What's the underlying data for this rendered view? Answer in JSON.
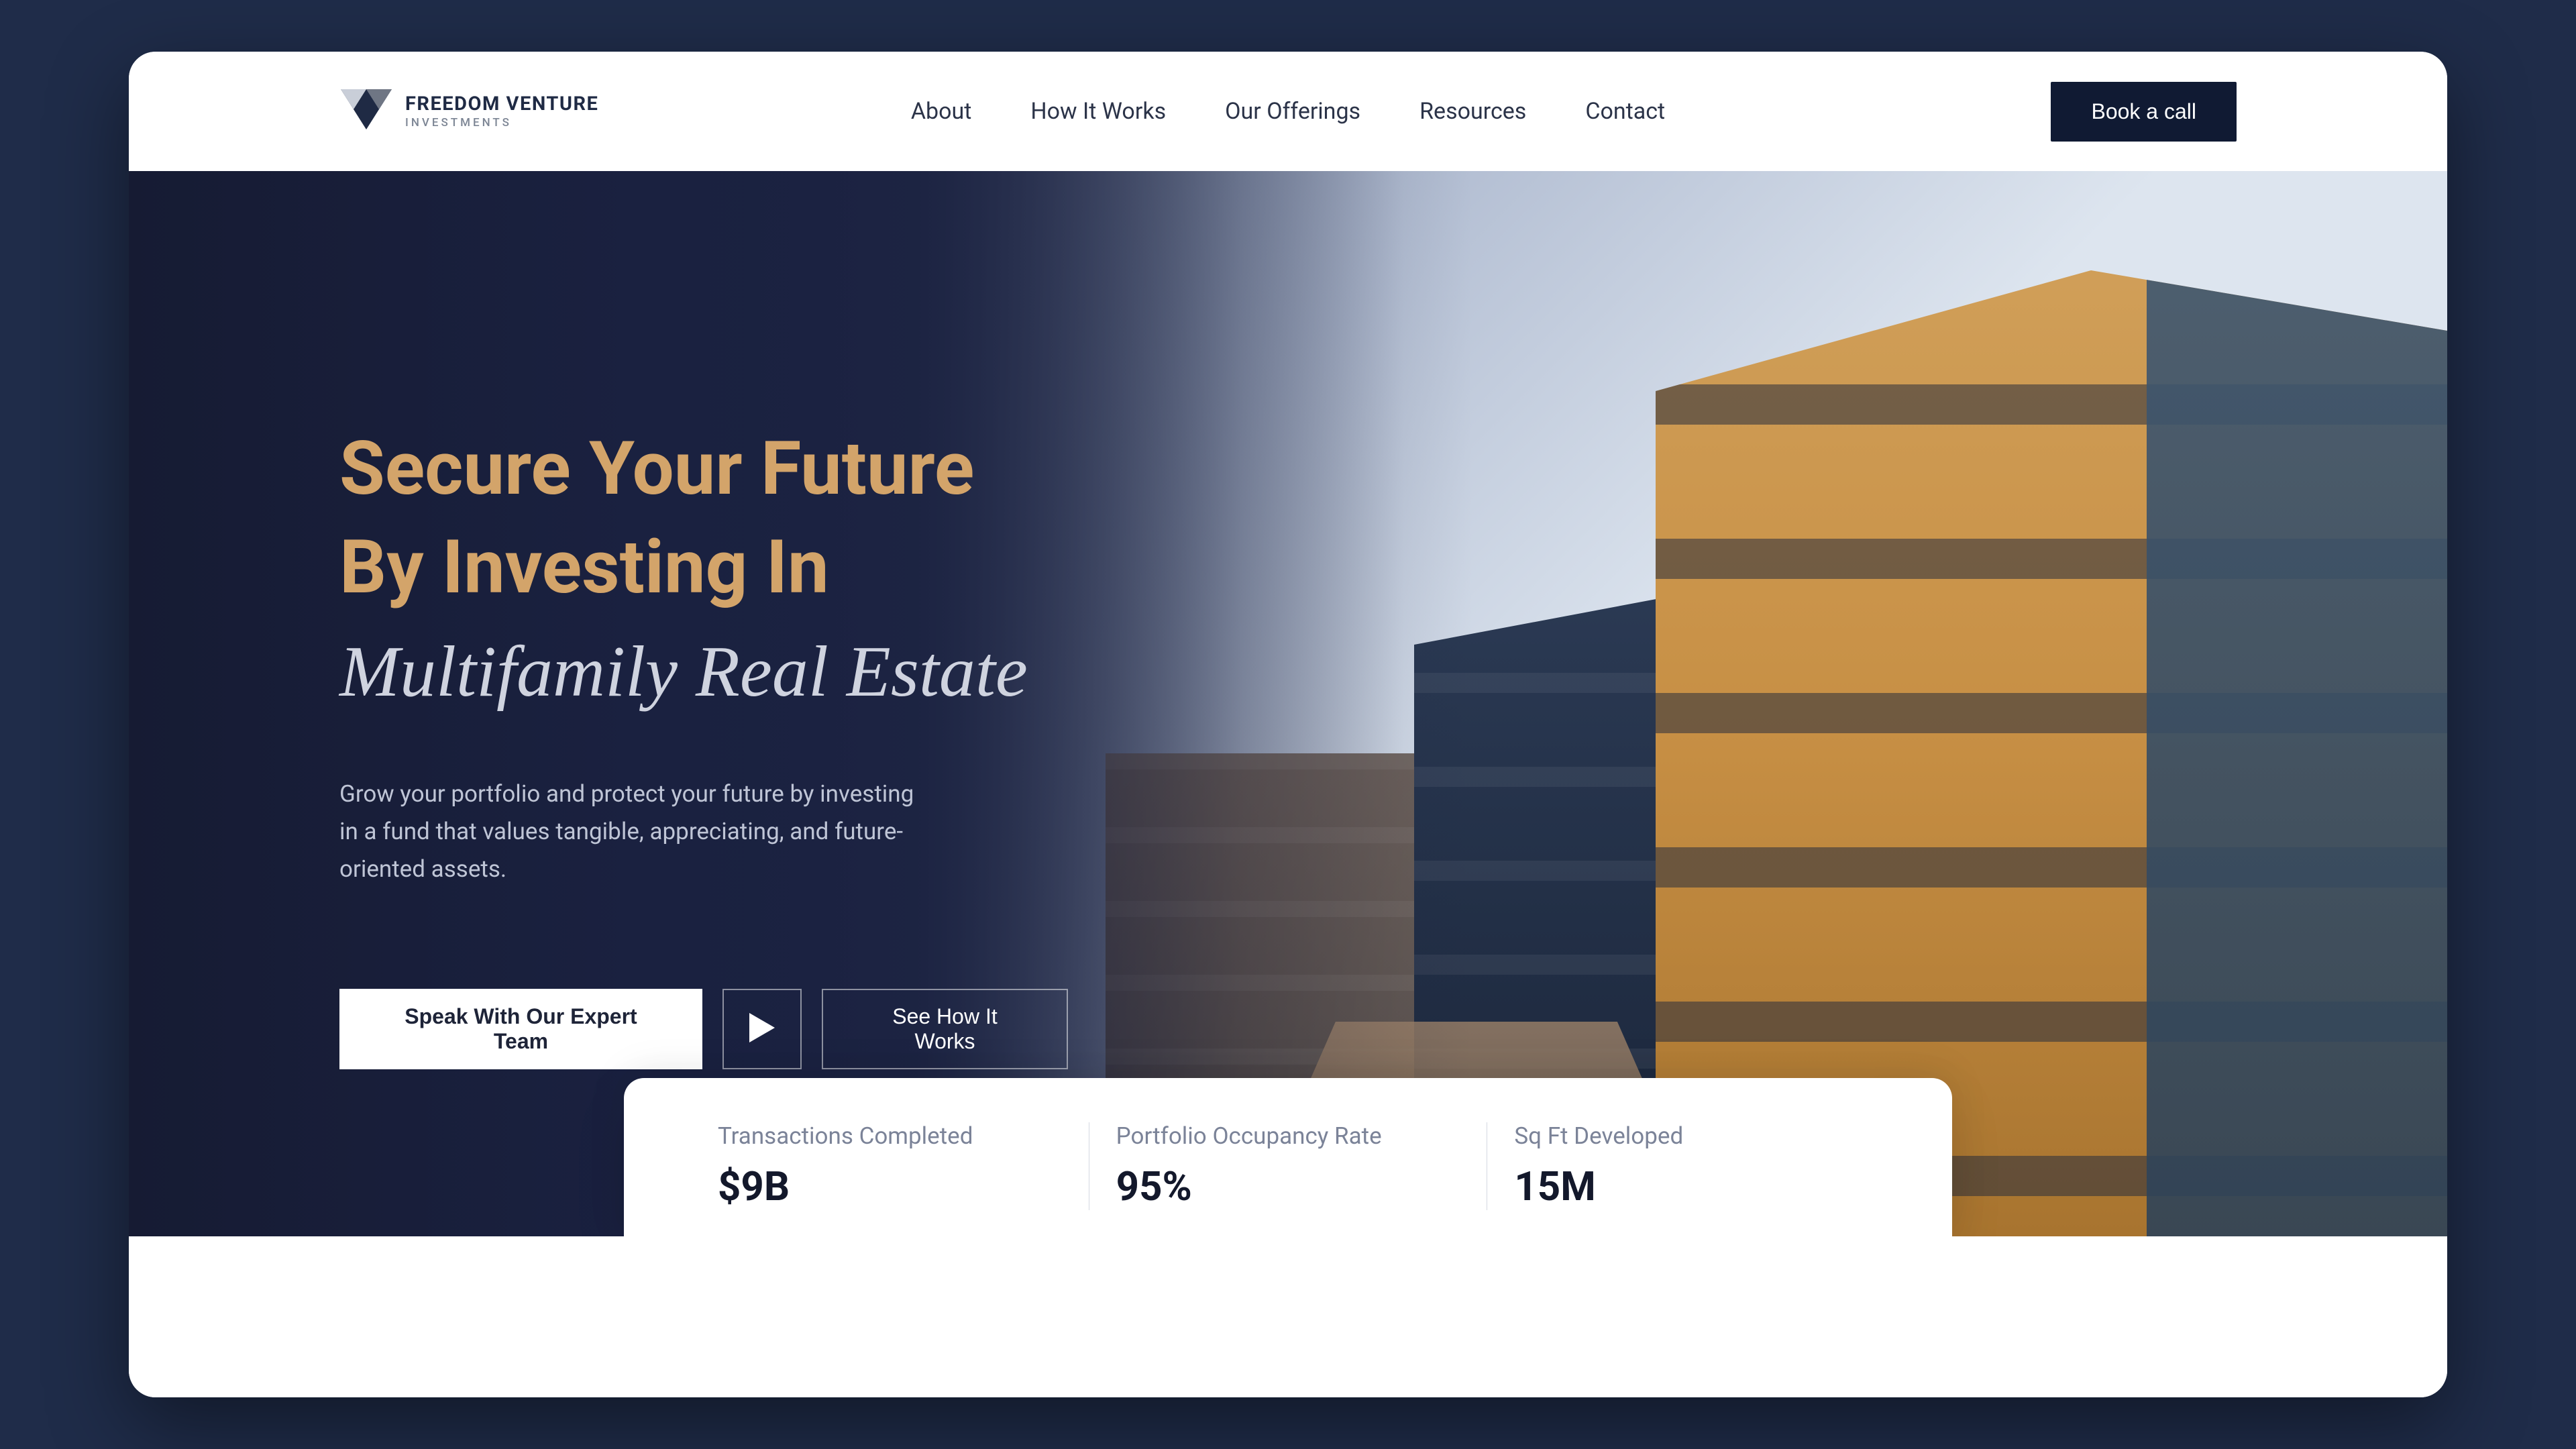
{
  "brand": {
    "name": "FREEDOM VENTURE",
    "tagline": "INVESTMENTS"
  },
  "nav": {
    "items": [
      {
        "label": "About"
      },
      {
        "label": "How It Works"
      },
      {
        "label": "Our Offerings"
      },
      {
        "label": "Resources"
      },
      {
        "label": "Contact"
      }
    ]
  },
  "header": {
    "cta_label": "Book a call"
  },
  "hero": {
    "headline_line1": "Secure Your Future",
    "headline_line2": "By Investing In",
    "subhead": "Multifamily Real Estate",
    "body": "Grow your portfolio and protect your future by investing in a fund that values tangible, appreciating, and future-oriented assets.",
    "primary_label": "Speak With Our Expert Team",
    "secondary_label": "See How It Works"
  },
  "stats": [
    {
      "label": "Transactions Completed",
      "value": "$9B"
    },
    {
      "label": "Portfolio Occupancy Rate",
      "value": "95%"
    },
    {
      "label": "Sq Ft Developed",
      "value": "15M"
    }
  ],
  "colors": {
    "accent": "#d3a46a",
    "navy": "#101a33"
  }
}
